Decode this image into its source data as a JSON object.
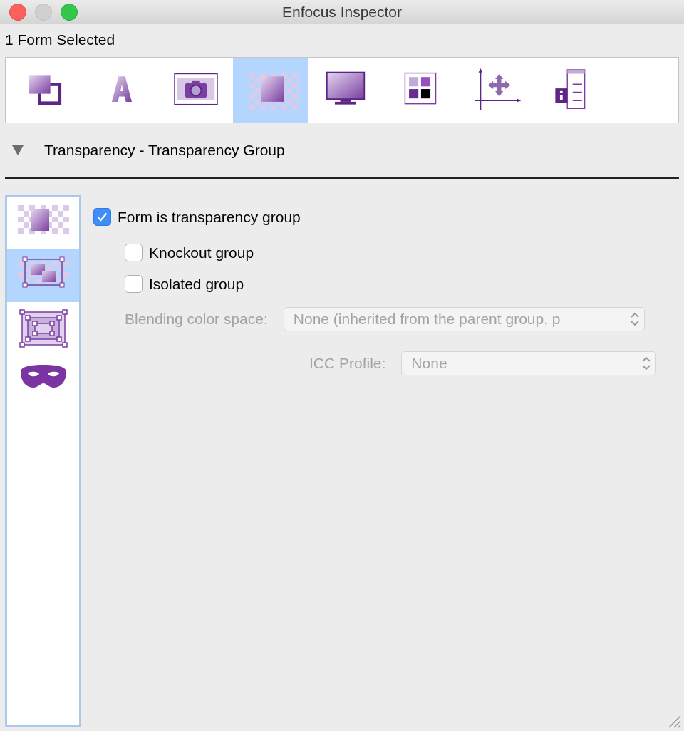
{
  "window": {
    "title": "Enfocus Inspector"
  },
  "selection_label": "1 Form Selected",
  "toolbar": [
    {
      "selected": false
    },
    {
      "selected": false
    },
    {
      "selected": false
    },
    {
      "selected": true
    },
    {
      "selected": false
    },
    {
      "selected": false
    },
    {
      "selected": false
    },
    {
      "selected": false
    }
  ],
  "section": {
    "title": "Transparency - Transparency Group",
    "expanded": true
  },
  "sidebar": [
    {
      "selected": false
    },
    {
      "selected": true
    },
    {
      "selected": false
    },
    {
      "selected": false
    }
  ],
  "options": [
    {
      "label": "Form is transparency group",
      "checked": true,
      "children": [
        {
          "label": "Knockout group",
          "checked": false
        },
        {
          "label": "Isolated group",
          "checked": false
        }
      ]
    }
  ],
  "fields": [
    {
      "label": "Blending color space:",
      "value": "None (inherited from the parent group, p",
      "disabled": true
    },
    {
      "label": "ICC Profile:",
      "value": "None",
      "disabled": true
    }
  ]
}
